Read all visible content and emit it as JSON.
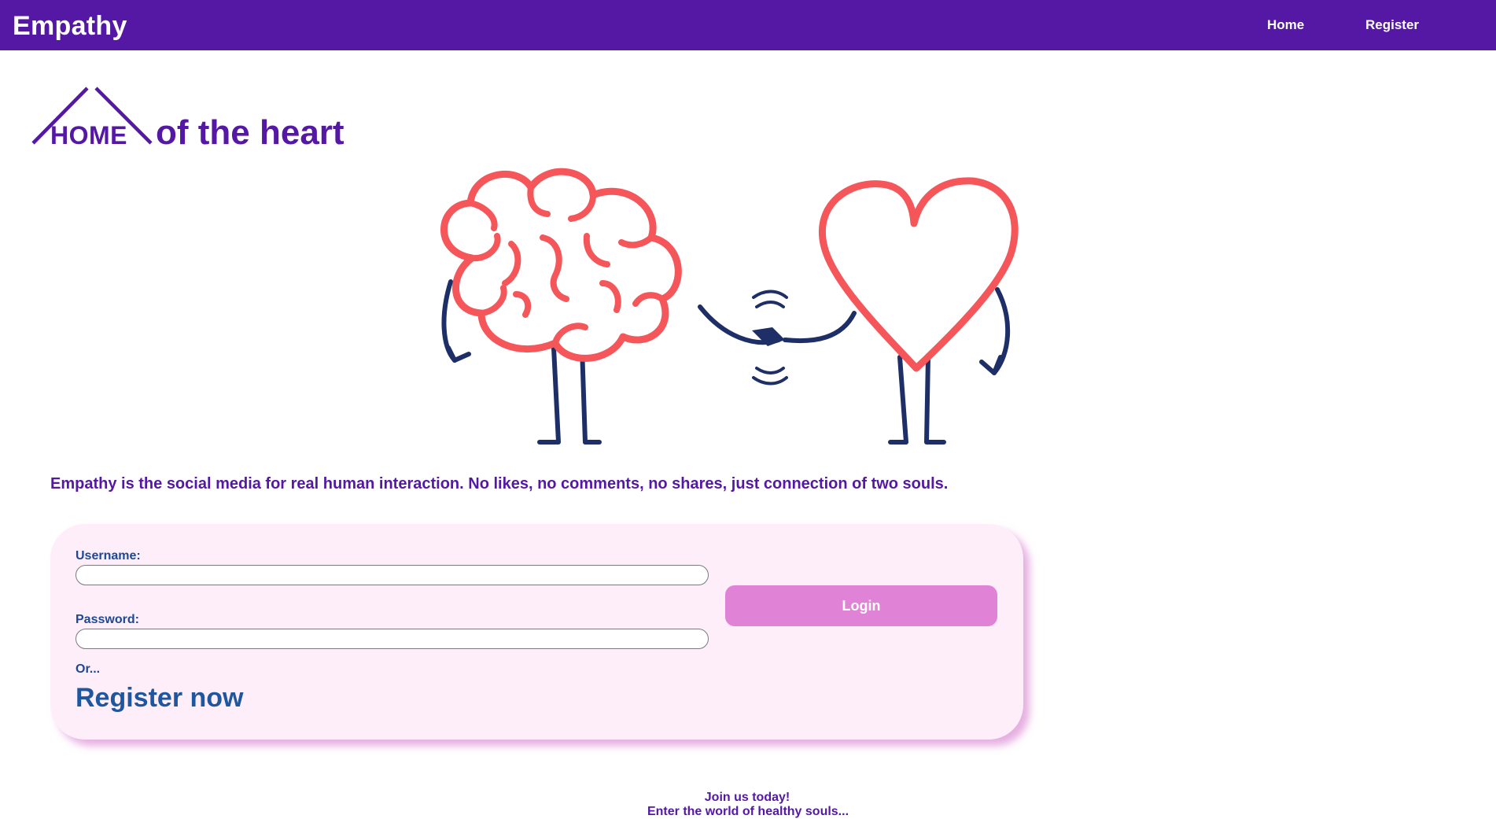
{
  "navbar": {
    "brand": "Empathy",
    "links": [
      {
        "label": "Home"
      },
      {
        "label": "Register"
      }
    ],
    "color": "#5418a4"
  },
  "logo": {
    "home_text": "HOME",
    "tagline": "of the heart"
  },
  "illustration": {
    "description_icons": [
      "brain-character-icon",
      "heart-character-icon",
      "handshake-icon"
    ],
    "accent": "#f4565a",
    "limb_color": "#1d2f66"
  },
  "intro_text": "Empathy is the social media for real human interaction. No likes, no comments, no shares, just connection of two souls.",
  "login_form": {
    "username_label": "Username:",
    "username_value": "",
    "password_label": "Password:",
    "password_value": "",
    "login_button": "Login",
    "or_text": "Or...",
    "register_link": "Register now",
    "card_color": "#fdeefa",
    "button_color": "#e083d6"
  },
  "footer": {
    "line1": "Join us today!",
    "line2": "Enter the world of healthy souls..."
  }
}
